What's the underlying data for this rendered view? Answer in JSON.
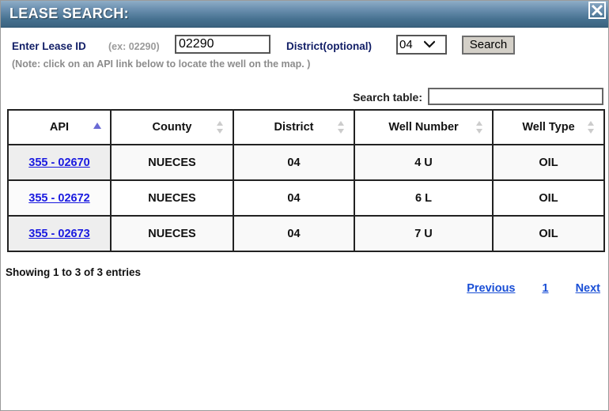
{
  "window": {
    "title": "LEASE SEARCH:",
    "close_icon": "close-x-icon"
  },
  "search_form": {
    "lease_label": "Enter Lease ID",
    "lease_example": "(ex: 02290)",
    "lease_value": "02290",
    "lease_placeholder": "",
    "district_label": "District(optional)",
    "district_value": "04",
    "district_options": [
      "04"
    ],
    "search_button": "Search",
    "note": "(Note: click on an API link below to locate the well on the map. )"
  },
  "filter": {
    "label": "Search table:",
    "value": "",
    "placeholder": ""
  },
  "table": {
    "columns": [
      {
        "label": "API",
        "sort": "asc"
      },
      {
        "label": "County",
        "sort": "both"
      },
      {
        "label": "District",
        "sort": "both"
      },
      {
        "label": "Well Number",
        "sort": "both"
      },
      {
        "label": "Well Type",
        "sort": "both"
      }
    ],
    "rows": [
      {
        "api": "355 - 02670",
        "county": "NUECES",
        "district": "04",
        "well_number": "4 U",
        "well_type": "OIL"
      },
      {
        "api": "355 - 02672",
        "county": "NUECES",
        "district": "04",
        "well_number": "6 L",
        "well_type": "OIL"
      },
      {
        "api": "355 - 02673",
        "county": "NUECES",
        "district": "04",
        "well_number": "7 U",
        "well_type": "OIL"
      }
    ]
  },
  "footer": {
    "showing": "Showing 1 to 3 of 3 entries",
    "previous": "Previous",
    "page_1": "1",
    "next": "Next"
  },
  "colors": {
    "titlebar_top": "#8fadc6",
    "titlebar_bottom": "#3c6480",
    "label_navy": "#111e66",
    "link_blue": "#1a1ae0",
    "pagination_blue": "#1a4fd6",
    "sort_active": "#6a6ad4",
    "sort_inactive": "#c8c8c8"
  }
}
